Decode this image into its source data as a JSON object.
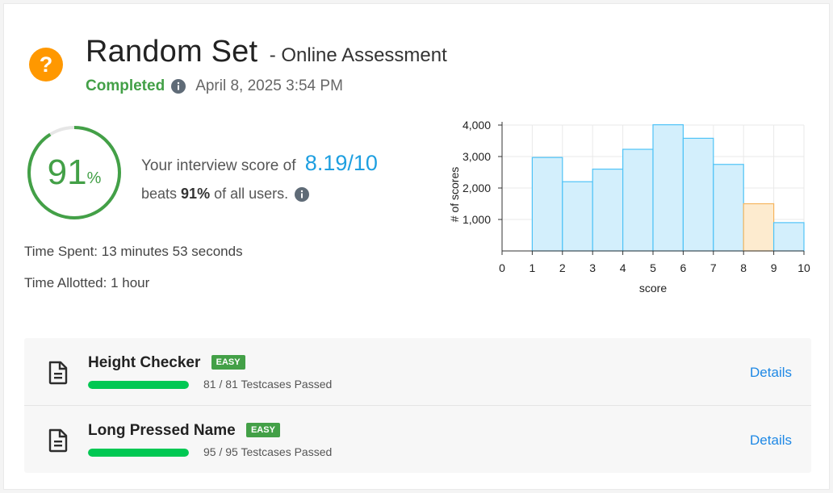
{
  "header": {
    "title": "Random Set",
    "subtitle": "- Online Assessment",
    "status": "Completed",
    "date": "April 8, 2025 3:54 PM",
    "icon": "question-icon",
    "icon_color": "#ff9800"
  },
  "score": {
    "percent_number": "91",
    "percent_sign": "%",
    "percent_value": 91,
    "line1_prefix": "Your interview score of",
    "value": "8.19/10",
    "line2_prefix": "beats",
    "line2_bold": "91%",
    "line2_suffix": "of all users."
  },
  "time": {
    "spent": "Time Spent: 13 minutes 53 seconds",
    "allotted": "Time Allotted: 1 hour"
  },
  "chart_data": {
    "type": "bar",
    "categories": [
      "0-1",
      "1-2",
      "2-3",
      "3-4",
      "4-5",
      "5-6",
      "6-7",
      "7-8",
      "8-9",
      "9-10"
    ],
    "values": [
      0,
      2970,
      2200,
      2600,
      3230,
      4010,
      3580,
      2750,
      1500,
      900
    ],
    "highlight_index": 8,
    "xticks": [
      "0",
      "1",
      "2",
      "3",
      "4",
      "5",
      "6",
      "7",
      "8",
      "9",
      "10"
    ],
    "yticks": [
      "1,000",
      "2,000",
      "3,000",
      "4,000"
    ],
    "ytick_values": [
      1000,
      2000,
      3000,
      4000
    ],
    "xlabel": "score",
    "ylabel": "# of scores",
    "ylim": [
      0,
      4000
    ],
    "xlim": [
      0,
      10
    ],
    "grid": true,
    "colors": {
      "bar": "#d3effc",
      "bar_stroke": "#4fc3f7",
      "highlight": "#fdebcf",
      "highlight_stroke": "#f6b55e"
    }
  },
  "problems": [
    {
      "name": "Height Checker",
      "difficulty": "EASY",
      "passed": "81 / 81 Testcases Passed",
      "progress": 1.0,
      "details": "Details"
    },
    {
      "name": "Long Pressed Name",
      "difficulty": "EASY",
      "passed": "95 / 95 Testcases Passed",
      "progress": 1.0,
      "details": "Details"
    }
  ]
}
